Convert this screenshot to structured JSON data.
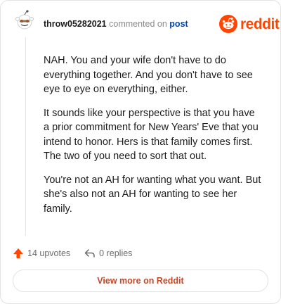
{
  "comment": {
    "username": "throw05282021",
    "commented_on_text": "commented on",
    "post_link_label": "post",
    "paragraphs": [
      "NAH. You and your wife don't have to do everything together. And you don't have to see eye to eye on everything, either.",
      "It sounds like your perspective is that you have a prior commitment for New Years' Eve that you intend to honor. Hers is that family comes first. The two of you need to sort that out.",
      "You're not an AH for wanting what you want. But she's also not an AH for wanting to see her family."
    ]
  },
  "brand": {
    "wordmark": "reddit",
    "logo_icon": "reddit-snoo-icon",
    "color": "#ff4500"
  },
  "actions": {
    "upvotes_label": "14 upvotes",
    "upvote_icon": "upvote-arrow-icon",
    "replies_label": "0 replies",
    "reply_icon": "reply-arrow-icon"
  },
  "footer": {
    "view_more_label": "View more on Reddit"
  },
  "colors": {
    "accent": "#ff4500",
    "link": "#0045ac",
    "view_more_text": "#c0492a"
  }
}
